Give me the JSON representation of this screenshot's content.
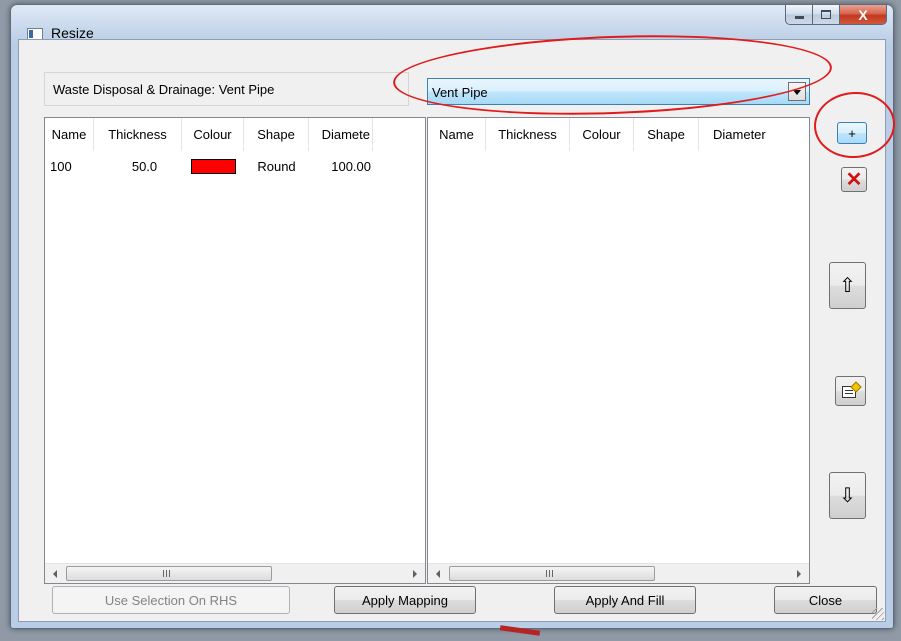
{
  "window": {
    "title": "Resize"
  },
  "caption": {
    "close_label": "X"
  },
  "header": {
    "path_label": "Waste Disposal & Drainage: Vent Pipe",
    "combo_value": "Vent Pipe"
  },
  "left_list": {
    "columns": [
      "Name",
      "Thickness",
      "Colour",
      "Shape",
      "Diamete"
    ],
    "rows": [
      {
        "name": "100",
        "thickness": "50.0",
        "colour": "#ff0000",
        "shape": "Round",
        "diameter": "100.00"
      }
    ]
  },
  "right_list": {
    "columns": [
      "Name",
      "Thickness",
      "Colour",
      "Shape",
      "Diameter"
    ],
    "rows": []
  },
  "side_buttons": {
    "add_label": "+",
    "delete_label": "✕",
    "up_label": "⇧",
    "down_label": "⇩"
  },
  "scrollbar": {
    "grip_label": "III"
  },
  "buttons": {
    "use_selection": "Use Selection On RHS",
    "apply_mapping": "Apply Mapping",
    "apply_and_fill": "Apply And Fill",
    "close": "Close"
  },
  "colors": {
    "row_colour": "#ff0000",
    "annotation": "#e01b1b"
  }
}
